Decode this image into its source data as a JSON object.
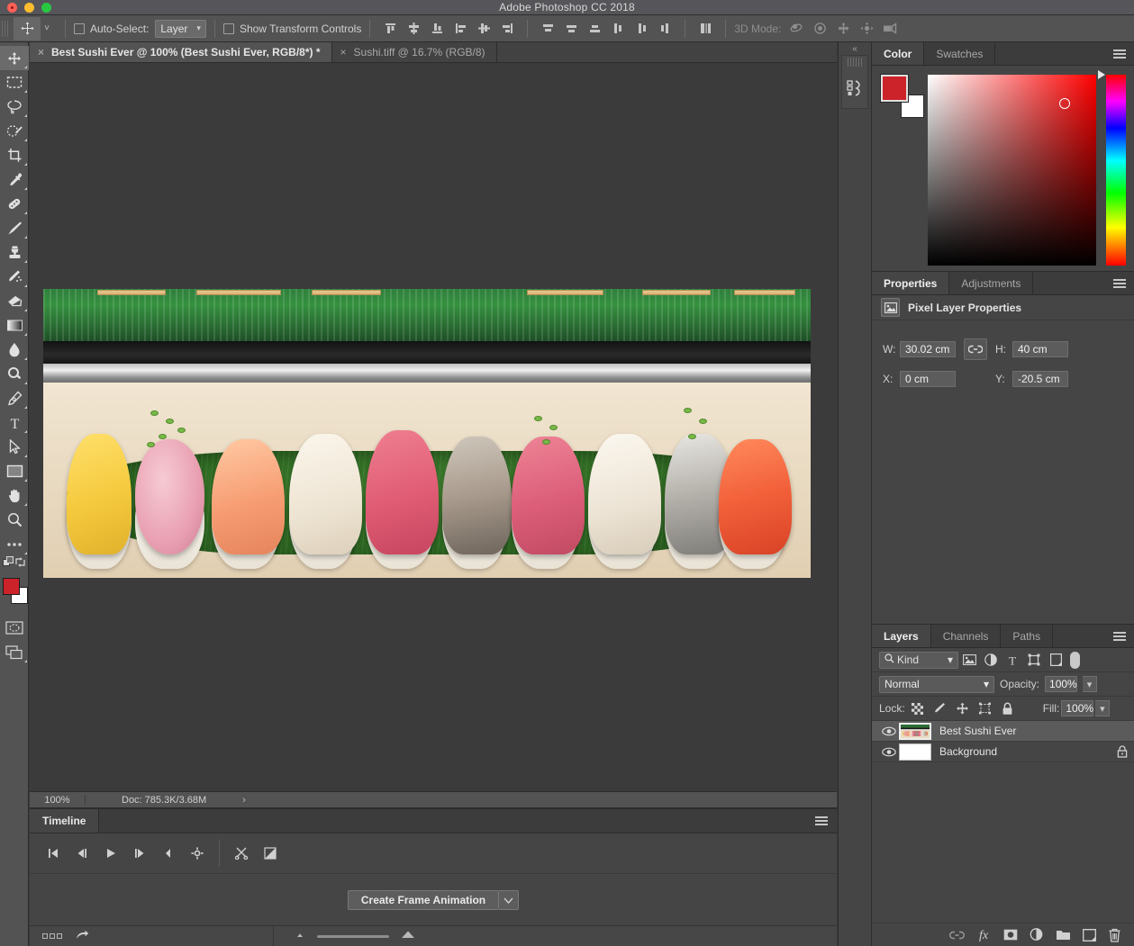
{
  "app": {
    "title": "Adobe Photoshop CC 2018"
  },
  "window_controls": {
    "close": "close",
    "minimize": "minimize",
    "maximize": "maximize"
  },
  "options_bar": {
    "tool_icon": "move-tool-icon",
    "auto_select_label": "Auto-Select:",
    "auto_select_checked": false,
    "layer_dropdown_value": "Layer",
    "show_transform_label": "Show Transform Controls",
    "show_transform_checked": false,
    "align_buttons": [
      "align-top-edges",
      "align-vertical-centers",
      "align-bottom-edges",
      "align-left-edges",
      "align-horizontal-centers",
      "align-right-edges"
    ],
    "distribute_buttons": [
      "distribute-top-edges",
      "distribute-vertical-centers",
      "distribute-bottom-edges",
      "distribute-left-edges",
      "distribute-horizontal-centers",
      "distribute-right-edges"
    ],
    "extras_button": "align-distribute-options",
    "mode3d_label": "3D Mode:",
    "mode3d_buttons": [
      "orbit-3d",
      "roll-3d",
      "pan-3d",
      "slide-3d",
      "camera-3d"
    ]
  },
  "tools": [
    {
      "name": "move-tool",
      "active": true
    },
    {
      "name": "rectangular-marquee-tool",
      "active": false
    },
    {
      "name": "lasso-tool",
      "active": false
    },
    {
      "name": "quick-selection-tool",
      "active": false
    },
    {
      "name": "crop-tool",
      "active": false
    },
    {
      "name": "eyedropper-tool",
      "active": false
    },
    {
      "name": "spot-healing-brush-tool",
      "active": false
    },
    {
      "name": "brush-tool",
      "active": false
    },
    {
      "name": "clone-stamp-tool",
      "active": false
    },
    {
      "name": "history-brush-tool",
      "active": false
    },
    {
      "name": "eraser-tool",
      "active": false
    },
    {
      "name": "gradient-tool",
      "active": false
    },
    {
      "name": "blur-tool",
      "active": false
    },
    {
      "name": "dodge-tool",
      "active": false
    },
    {
      "name": "pen-tool",
      "active": false
    },
    {
      "name": "type-tool",
      "active": false
    },
    {
      "name": "path-selection-tool",
      "active": false
    },
    {
      "name": "rectangle-tool",
      "active": false
    },
    {
      "name": "hand-tool",
      "active": false
    },
    {
      "name": "zoom-tool",
      "active": false
    },
    {
      "name": "edit-toolbar-tool",
      "active": false
    }
  ],
  "tool_colors": {
    "foreground": "#cc2229",
    "background": "#ffffff"
  },
  "document_tabs": [
    {
      "title": "Best Sushi Ever @ 100% (Best Sushi Ever, RGB/8*) *",
      "active": true,
      "close": "×"
    },
    {
      "title": "Sushi.tiff @ 16.7% (RGB/8)",
      "active": false,
      "close": "×"
    }
  ],
  "status_bar": {
    "zoom": "100%",
    "doc_info": "Doc: 785.3K/3.68M",
    "expand_arrow": "›"
  },
  "timeline": {
    "tab_label": "Timeline",
    "menu_icon": "panel-menu-icon",
    "transport_buttons": [
      "go-to-first-frame",
      "previous-frame",
      "play",
      "next-frame",
      "audio-mute",
      "timeline-settings"
    ],
    "edit_buttons": [
      "split-clip",
      "transition"
    ],
    "create_button_label": "Create Frame Animation",
    "create_dropdown": "chevron-down-icon",
    "bottom_left_icons": [
      "frame-thumbnails",
      "render-video"
    ],
    "zoom_out_icon": "zoom-out-small",
    "zoom_in_icon": "zoom-in-large"
  },
  "mini_dock": {
    "expand_icon": "«",
    "panel_icon": "libraries-icon"
  },
  "color_panel": {
    "tabs": [
      {
        "label": "Color",
        "active": true
      },
      {
        "label": "Swatches",
        "active": false
      }
    ],
    "menu_icon": "panel-menu-icon",
    "foreground_color": "#cc2229",
    "background_color": "#ffffff",
    "picker_type": "hue-cube"
  },
  "properties_panel": {
    "tabs": [
      {
        "label": "Properties",
        "active": true
      },
      {
        "label": "Adjustments",
        "active": false
      }
    ],
    "menu_icon": "panel-menu-icon",
    "header_icon": "pixel-layer-icon",
    "header_title": "Pixel Layer Properties",
    "fields": {
      "w_label": "W:",
      "w_value": "30.02 cm",
      "link_icon": "link-icon",
      "h_label": "H:",
      "h_value": "40 cm",
      "x_label": "X:",
      "x_value": "0 cm",
      "y_label": "Y:",
      "y_value": "-20.5 cm"
    }
  },
  "layers_panel": {
    "tabs": [
      {
        "label": "Layers",
        "active": true
      },
      {
        "label": "Channels",
        "active": false
      },
      {
        "label": "Paths",
        "active": false
      }
    ],
    "menu_icon": "panel-menu-icon",
    "filter": {
      "kind_label": "Kind",
      "search_icon": "search-icon",
      "type_filters": [
        "filter-pixel",
        "filter-adjustment",
        "filter-type",
        "filter-shape",
        "filter-smart-object"
      ],
      "toggle": "filter-enable-toggle"
    },
    "blend_mode": "Normal",
    "opacity_label": "Opacity:",
    "opacity_value": "100%",
    "lock_label": "Lock:",
    "lock_buttons": [
      "lock-transparent-pixels",
      "lock-image-pixels",
      "lock-position",
      "lock-artboard-nesting",
      "lock-all"
    ],
    "fill_label": "Fill:",
    "fill_value": "100%",
    "layers": [
      {
        "name": "Best Sushi Ever",
        "visible": true,
        "selected": true,
        "locked": false,
        "thumb": "photo"
      },
      {
        "name": "Background",
        "visible": true,
        "selected": false,
        "locked": true,
        "thumb": "white"
      }
    ],
    "footer_buttons": [
      "link-layers",
      "layer-style-fx",
      "layer-mask",
      "new-fill-adjustment",
      "new-group",
      "new-layer",
      "delete-layer"
    ]
  },
  "canvas": {
    "artboard_alt": "sushi-platter-photo",
    "zoom_level": "100%"
  }
}
